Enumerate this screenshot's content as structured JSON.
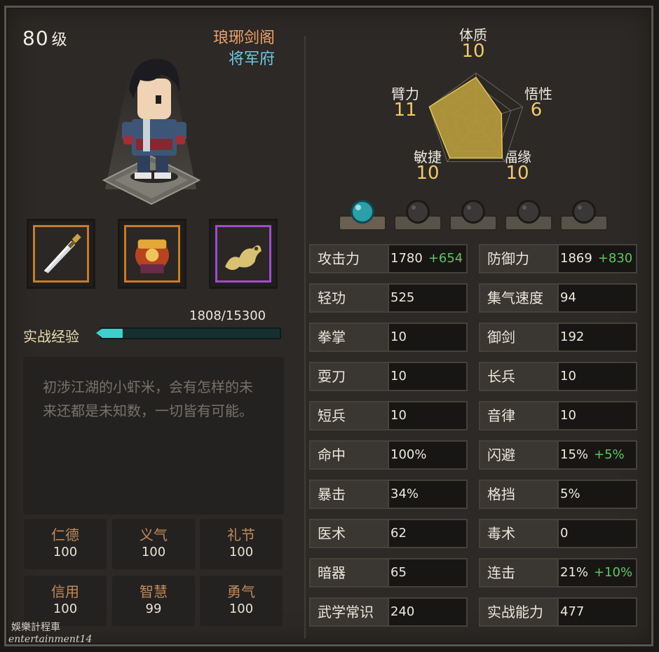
{
  "character": {
    "level_value": "80",
    "level_unit": "级",
    "sect": "琅琊剑阁",
    "affiliation": "将军府"
  },
  "equipment": [
    {
      "name": "sword-icon",
      "rarity": "orange"
    },
    {
      "name": "armor-icon",
      "rarity": "orange"
    },
    {
      "name": "golden-dragon-icon",
      "rarity": "purple"
    }
  ],
  "experience": {
    "label": "实战经验",
    "current": 1808,
    "max": 15300,
    "text": "1808/15300"
  },
  "description": "初涉江湖的小虾米，会有怎样的未来还都是未知数，一切皆有可能。",
  "virtues": [
    {
      "name": "仁德",
      "value": "100"
    },
    {
      "name": "义气",
      "value": "100"
    },
    {
      "name": "礼节",
      "value": "100"
    },
    {
      "name": "信用",
      "value": "100"
    },
    {
      "name": "智慧",
      "value": "99"
    },
    {
      "name": "勇气",
      "value": "100"
    }
  ],
  "attributes": {
    "constitution": {
      "label": "体质",
      "value": "10"
    },
    "comprehension": {
      "label": "悟性",
      "value": "6"
    },
    "fortune": {
      "label": "福缘",
      "value": "10"
    },
    "agility": {
      "label": "敏捷",
      "value": "10"
    },
    "strength": {
      "label": "臂力",
      "value": "11"
    }
  },
  "radar_data": {
    "order": [
      "体质",
      "悟性",
      "福缘",
      "敏捷",
      "臂力"
    ],
    "values": [
      10,
      6,
      10,
      10,
      11
    ],
    "max": 11
  },
  "gem_slots": [
    {
      "state": "filled",
      "color": "#2aa0a8"
    },
    {
      "state": "empty",
      "color": "#3a3836"
    },
    {
      "state": "empty",
      "color": "#3a3836"
    },
    {
      "state": "empty",
      "color": "#3a3836"
    },
    {
      "state": "empty",
      "color": "#3a3836"
    }
  ],
  "stats_left": [
    {
      "name": "攻击力",
      "value": "1780",
      "bonus": "+654"
    },
    {
      "name": "轻功",
      "value": "525",
      "bonus": ""
    },
    {
      "name": "拳掌",
      "value": "10",
      "bonus": ""
    },
    {
      "name": "耍刀",
      "value": "10",
      "bonus": ""
    },
    {
      "name": "短兵",
      "value": "10",
      "bonus": ""
    },
    {
      "name": "命中",
      "value": "100%",
      "bonus": ""
    },
    {
      "name": "暴击",
      "value": "34%",
      "bonus": ""
    },
    {
      "name": "医术",
      "value": "62",
      "bonus": ""
    },
    {
      "name": "暗器",
      "value": "65",
      "bonus": ""
    },
    {
      "name": "武学常识",
      "value": "240",
      "bonus": ""
    }
  ],
  "stats_right": [
    {
      "name": "防御力",
      "value": "1869",
      "bonus": "+830"
    },
    {
      "name": "集气速度",
      "value": "94",
      "bonus": ""
    },
    {
      "name": "御剑",
      "value": "192",
      "bonus": ""
    },
    {
      "name": "长兵",
      "value": "10",
      "bonus": ""
    },
    {
      "name": "音律",
      "value": "10",
      "bonus": ""
    },
    {
      "name": "闪避",
      "value": "15%",
      "bonus": "+5%"
    },
    {
      "name": "格挡",
      "value": "5%",
      "bonus": ""
    },
    {
      "name": "毒术",
      "value": "0",
      "bonus": ""
    },
    {
      "name": "连击",
      "value": "21%",
      "bonus": "+10%"
    },
    {
      "name": "实战能力",
      "value": "477",
      "bonus": ""
    }
  ],
  "watermark": {
    "line1": "娛樂計程車",
    "line2": "entertainment14"
  },
  "colors": {
    "bonus": "#5cc85c",
    "sect": "#f0a26a",
    "affiliation": "#6ec9e0",
    "attribute_value": "#efc96b",
    "virtue_name": "#c08a5c",
    "exp_fill": "#3ed0cb"
  }
}
